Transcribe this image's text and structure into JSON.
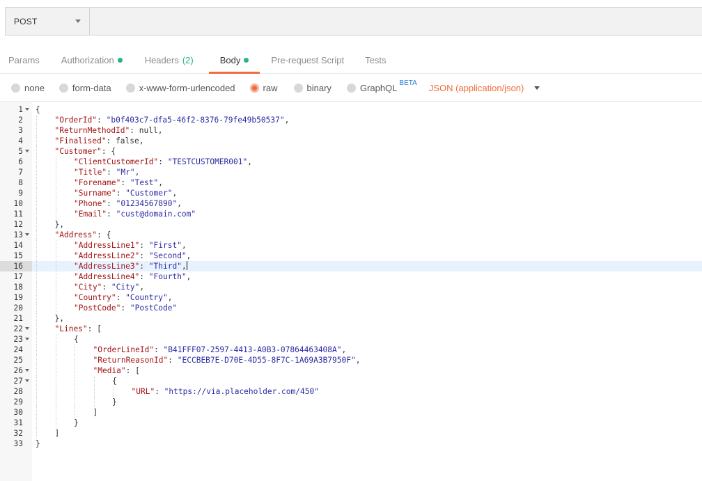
{
  "request": {
    "method": "POST",
    "url": "",
    "url_placeholder": ""
  },
  "tabs": {
    "params": "Params",
    "authorization": "Authorization",
    "headers": "Headers",
    "headers_count": "(2)",
    "body": "Body",
    "prerequest": "Pre-request Script",
    "tests": "Tests"
  },
  "body_types": {
    "none": "none",
    "form_data": "form-data",
    "urlencoded": "x-www-form-urlencoded",
    "raw": "raw",
    "binary": "binary",
    "graphql": "GraphQL",
    "graphql_badge": "BETA",
    "selected": "raw",
    "content_type": "JSON (application/json)"
  },
  "colors": {
    "accent": "#f26b3a",
    "status_dot": "#26b47f",
    "json_key": "#a31515",
    "json_string": "#2a2aa5"
  },
  "editor": {
    "active_line": 16,
    "lines": [
      {
        "n": 1,
        "fold": true,
        "indent": 0,
        "tokens": [
          [
            "p",
            "{"
          ]
        ]
      },
      {
        "n": 2,
        "indent": 1,
        "tokens": [
          [
            "k",
            "\"OrderId\""
          ],
          [
            "p",
            ": "
          ],
          [
            "s",
            "\"b0f403c7-dfa5-46f2-8376-79fe49b50537\""
          ],
          [
            "p",
            ","
          ]
        ]
      },
      {
        "n": 3,
        "indent": 1,
        "tokens": [
          [
            "k",
            "\"ReturnMethodId\""
          ],
          [
            "p",
            ": null,"
          ]
        ]
      },
      {
        "n": 4,
        "indent": 1,
        "tokens": [
          [
            "k",
            "\"Finalised\""
          ],
          [
            "p",
            ": false,"
          ]
        ]
      },
      {
        "n": 5,
        "fold": true,
        "indent": 1,
        "tokens": [
          [
            "k",
            "\"Customer\""
          ],
          [
            "p",
            ": {"
          ]
        ]
      },
      {
        "n": 6,
        "indent": 2,
        "tokens": [
          [
            "k",
            "\"ClientCustomerId\""
          ],
          [
            "p",
            ": "
          ],
          [
            "s",
            "\"TESTCUSTOMER001\""
          ],
          [
            "p",
            ","
          ]
        ]
      },
      {
        "n": 7,
        "indent": 2,
        "tokens": [
          [
            "k",
            "\"Title\""
          ],
          [
            "p",
            ": "
          ],
          [
            "s",
            "\"Mr\""
          ],
          [
            "p",
            ","
          ]
        ]
      },
      {
        "n": 8,
        "indent": 2,
        "tokens": [
          [
            "k",
            "\"Forename\""
          ],
          [
            "p",
            ": "
          ],
          [
            "s",
            "\"Test\""
          ],
          [
            "p",
            ","
          ]
        ]
      },
      {
        "n": 9,
        "indent": 2,
        "tokens": [
          [
            "k",
            "\"Surname\""
          ],
          [
            "p",
            ": "
          ],
          [
            "s",
            "\"Customer\""
          ],
          [
            "p",
            ","
          ]
        ]
      },
      {
        "n": 10,
        "indent": 2,
        "tokens": [
          [
            "k",
            "\"Phone\""
          ],
          [
            "p",
            ": "
          ],
          [
            "s",
            "\"01234567890\""
          ],
          [
            "p",
            ","
          ]
        ]
      },
      {
        "n": 11,
        "indent": 2,
        "tokens": [
          [
            "k",
            "\"Email\""
          ],
          [
            "p",
            ": "
          ],
          [
            "s",
            "\"cust@domain.com\""
          ]
        ]
      },
      {
        "n": 12,
        "indent": 1,
        "tokens": [
          [
            "p",
            "},"
          ]
        ]
      },
      {
        "n": 13,
        "fold": true,
        "indent": 1,
        "tokens": [
          [
            "k",
            "\"Address\""
          ],
          [
            "p",
            ": {"
          ]
        ]
      },
      {
        "n": 14,
        "indent": 2,
        "tokens": [
          [
            "k",
            "\"AddressLine1\""
          ],
          [
            "p",
            ": "
          ],
          [
            "s",
            "\"First\""
          ],
          [
            "p",
            ","
          ]
        ]
      },
      {
        "n": 15,
        "indent": 2,
        "tokens": [
          [
            "k",
            "\"AddressLine2\""
          ],
          [
            "p",
            ": "
          ],
          [
            "s",
            "\"Second\""
          ],
          [
            "p",
            ","
          ]
        ]
      },
      {
        "n": 16,
        "indent": 2,
        "cursor": true,
        "tokens": [
          [
            "k",
            "\"AddressLine3\""
          ],
          [
            "p",
            ": "
          ],
          [
            "s",
            "\"Third\""
          ],
          [
            "p",
            ","
          ]
        ]
      },
      {
        "n": 17,
        "indent": 2,
        "tokens": [
          [
            "k",
            "\"AddressLine4\""
          ],
          [
            "p",
            ": "
          ],
          [
            "s",
            "\"Fourth\""
          ],
          [
            "p",
            ","
          ]
        ]
      },
      {
        "n": 18,
        "indent": 2,
        "tokens": [
          [
            "k",
            "\"City\""
          ],
          [
            "p",
            ": "
          ],
          [
            "s",
            "\"City\""
          ],
          [
            "p",
            ","
          ]
        ]
      },
      {
        "n": 19,
        "indent": 2,
        "tokens": [
          [
            "k",
            "\"Country\""
          ],
          [
            "p",
            ": "
          ],
          [
            "s",
            "\"Country\""
          ],
          [
            "p",
            ","
          ]
        ]
      },
      {
        "n": 20,
        "indent": 2,
        "tokens": [
          [
            "k",
            "\"PostCode\""
          ],
          [
            "p",
            ": "
          ],
          [
            "s",
            "\"PostCode\""
          ]
        ]
      },
      {
        "n": 21,
        "indent": 1,
        "tokens": [
          [
            "p",
            "},"
          ]
        ]
      },
      {
        "n": 22,
        "fold": true,
        "indent": 1,
        "tokens": [
          [
            "k",
            "\"Lines\""
          ],
          [
            "p",
            ": ["
          ]
        ]
      },
      {
        "n": 23,
        "fold": true,
        "indent": 2,
        "tokens": [
          [
            "p",
            "{"
          ]
        ]
      },
      {
        "n": 24,
        "indent": 3,
        "tokens": [
          [
            "k",
            "\"OrderLineId\""
          ],
          [
            "p",
            ": "
          ],
          [
            "s",
            "\"B41FFF07-2597-4413-A0B3-07864463408A\""
          ],
          [
            "p",
            ","
          ]
        ]
      },
      {
        "n": 25,
        "indent": 3,
        "tokens": [
          [
            "k",
            "\"ReturnReasonId\""
          ],
          [
            "p",
            ": "
          ],
          [
            "s",
            "\"ECCBEB7E-D70E-4D55-8F7C-1A69A3B7950F\""
          ],
          [
            "p",
            ","
          ]
        ]
      },
      {
        "n": 26,
        "fold": true,
        "indent": 3,
        "tokens": [
          [
            "k",
            "\"Media\""
          ],
          [
            "p",
            ": ["
          ]
        ]
      },
      {
        "n": 27,
        "fold": true,
        "indent": 4,
        "tokens": [
          [
            "p",
            "{"
          ]
        ]
      },
      {
        "n": 28,
        "indent": 5,
        "tokens": [
          [
            "k",
            "\"URL\""
          ],
          [
            "p",
            ": "
          ],
          [
            "s",
            "\"https://via.placeholder.com/450\""
          ]
        ]
      },
      {
        "n": 29,
        "indent": 4,
        "tokens": [
          [
            "p",
            "}"
          ]
        ]
      },
      {
        "n": 30,
        "indent": 3,
        "tokens": [
          [
            "p",
            "]"
          ]
        ]
      },
      {
        "n": 31,
        "indent": 2,
        "tokens": [
          [
            "p",
            "}"
          ]
        ]
      },
      {
        "n": 32,
        "indent": 1,
        "tokens": [
          [
            "p",
            "]"
          ]
        ]
      },
      {
        "n": 33,
        "indent": 0,
        "tokens": [
          [
            "p",
            "}"
          ]
        ]
      }
    ]
  }
}
